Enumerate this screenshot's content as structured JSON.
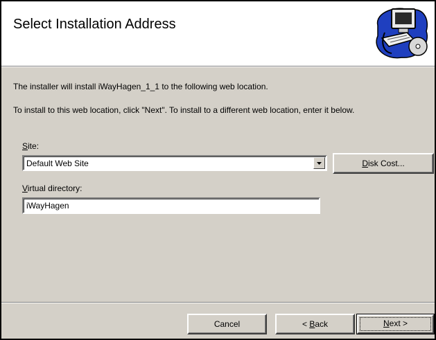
{
  "header": {
    "title": "Select Installation Address",
    "logo_icon": "computer-install-icon"
  },
  "body": {
    "intro": "The installer will install iWayHagen_1_1 to the following web location.",
    "instruction": "To install to this web location, click \"Next\". To install to a different web location, enter it below."
  },
  "site": {
    "label_accel": "S",
    "label_rest": "ite:",
    "selected": "Default Web Site"
  },
  "virtual_directory": {
    "label_accel": "V",
    "label_rest": "irtual directory:",
    "value": "iWayHagen"
  },
  "buttons": {
    "disk_cost_accel": "D",
    "disk_cost_rest": "isk Cost...",
    "cancel": "Cancel",
    "back_prefix": "< ",
    "back_accel": "B",
    "back_rest": "ack",
    "next_accel": "N",
    "next_rest": "ext >"
  },
  "colors": {
    "dialog_bg": "#d4d0c8",
    "header_bg": "#ffffff",
    "logo_blue": "#1f3fbf"
  }
}
